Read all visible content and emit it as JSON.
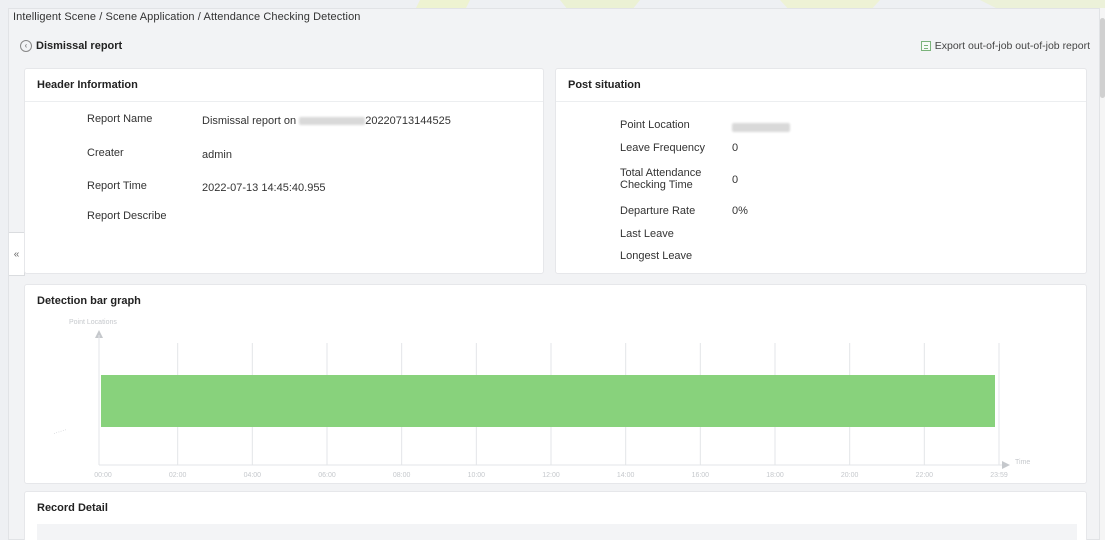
{
  "breadcrumb": "Intelligent Scene / Scene Application / Attendance Checking Detection",
  "back_label": "Dismissal report",
  "export_label": "Export out-of-job out-of-job report",
  "collapse_glyph": "«",
  "header_info": {
    "title": "Header Information",
    "rows": [
      {
        "label": "Report Name",
        "value": "Dismissal report on ",
        "value_suffix": "20220713144525"
      },
      {
        "label": "Creater",
        "value": "admin"
      },
      {
        "label": "Report Time",
        "value": "2022-07-13 14:45:40.955"
      },
      {
        "label": "Report Describe",
        "value": ""
      }
    ]
  },
  "post_situation": {
    "title": "Post situation",
    "rows": [
      {
        "label": "Point Location",
        "value": ""
      },
      {
        "label": "Leave Frequency",
        "value": "0"
      },
      {
        "label": "Total Attendance Checking Time",
        "value": "0"
      },
      {
        "label": "Departure Rate",
        "value": "0%"
      },
      {
        "label": "Last Leave",
        "value": ""
      },
      {
        "label": "Longest Leave",
        "value": ""
      }
    ]
  },
  "graph": {
    "title": "Detection bar graph"
  },
  "record": {
    "title": "Record Detail"
  },
  "colors": {
    "bar_fill": "#88d27c",
    "grid": "#e3e5e8",
    "axis_text": "#c5c8cc"
  },
  "chart_data": {
    "type": "bar",
    "orientation": "horizontal",
    "ylabel": "Point Locations",
    "xlabel": "Time",
    "x_ticks": [
      "00:00",
      "02:00",
      "04:00",
      "06:00",
      "08:00",
      "10:00",
      "12:00",
      "14:00",
      "16:00",
      "18:00",
      "20:00",
      "22:00",
      "23:59"
    ],
    "x_range_hours": [
      0,
      24
    ],
    "bars": [
      {
        "start_hour": 0,
        "end_hour": 24
      }
    ],
    "grid": true
  }
}
